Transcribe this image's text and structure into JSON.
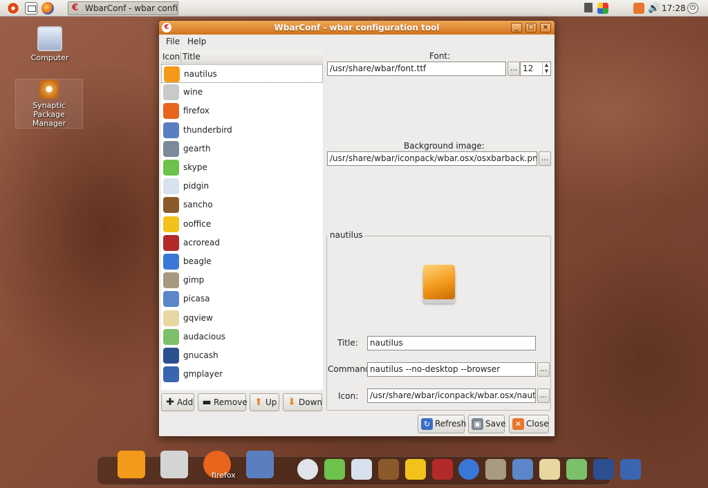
{
  "top_panel": {
    "task_title": "WbarConf - wbar confi...",
    "clock": "17:28",
    "icons": [
      "ubuntu-menu-icon",
      "show-desktop-icon",
      "firefox-icon",
      "network-icon",
      "update-notifier-icon",
      "notification-icon",
      "volume-icon",
      "power-icon"
    ]
  },
  "desktop": {
    "icons": [
      {
        "label": "Computer",
        "icon": "computer-icon"
      },
      {
        "label": "Synaptic Package Manager",
        "icon": "synaptic-icon"
      }
    ]
  },
  "window": {
    "title": "WbarConf - wbar configuration tool",
    "controls": {
      "minimize": "_",
      "maximize": "□",
      "close": "×"
    },
    "menu": {
      "file": "File",
      "help": "Help"
    },
    "list": {
      "columns": {
        "icon": "Icon",
        "title": "Title"
      },
      "selected": "nautilus",
      "items": [
        {
          "label": "nautilus",
          "color": "#f49a1a"
        },
        {
          "label": "wine",
          "color": "#c9c9c9"
        },
        {
          "label": "firefox",
          "color": "#e8651b"
        },
        {
          "label": "thunderbird",
          "color": "#5a7fc0"
        },
        {
          "label": "gearth",
          "color": "#7a8a9a"
        },
        {
          "label": "skype",
          "color": "#6cc24a"
        },
        {
          "label": "pidgin",
          "color": "#d8e2ee"
        },
        {
          "label": "sancho",
          "color": "#8b5a2b"
        },
        {
          "label": "ooffice",
          "color": "#f2c21a"
        },
        {
          "label": "acroread",
          "color": "#b22a2a"
        },
        {
          "label": "beagle",
          "color": "#3a78d8"
        },
        {
          "label": "gimp",
          "color": "#a89a80"
        },
        {
          "label": "picasa",
          "color": "#5b86c9"
        },
        {
          "label": "gqview",
          "color": "#e7d7a0"
        },
        {
          "label": "audacious",
          "color": "#7cc06a"
        },
        {
          "label": "gnucash",
          "color": "#2c4f8f"
        },
        {
          "label": "gmplayer",
          "color": "#3a66b0"
        }
      ]
    },
    "list_buttons": {
      "add": "Add",
      "remove": "Remove",
      "up": "Up",
      "down": "Down"
    },
    "font": {
      "label": "Font:",
      "path": "/usr/share/wbar/font.ttf",
      "browse": "...",
      "size": "12"
    },
    "background": {
      "label": "Background image:",
      "path": "/usr/share/wbar/iconpack/wbar.osx/osxbarback.png",
      "browse": "..."
    },
    "item": {
      "frame_title": "nautilus",
      "title_label": "Title:",
      "title_value": "nautilus",
      "command_label": "Command:",
      "command_value": "nautilus --no-desktop --browser",
      "icon_label": "Icon:",
      "icon_value": "/usr/share/wbar/iconpack/wbar.osx/nautilus.pn",
      "browse": "..."
    },
    "actions": {
      "refresh": "Refresh",
      "save": "Save",
      "close": "Close"
    }
  },
  "dock": {
    "hover_label": "firefox",
    "items": [
      {
        "name": "nautilus",
        "color": "#f49a1a"
      },
      {
        "name": "wine",
        "color": "#d4d4d4"
      },
      {
        "name": "firefox",
        "color": "#e8651b"
      },
      {
        "name": "thunderbird",
        "color": "#5a7fc0"
      },
      {
        "name": "gearth",
        "color": "#e0e4ea"
      },
      {
        "name": "skype",
        "color": "#6cc24a"
      },
      {
        "name": "pidgin",
        "color": "#d8e2ee"
      },
      {
        "name": "sancho",
        "color": "#8b5a2b"
      },
      {
        "name": "ooffice",
        "color": "#f2c21a"
      },
      {
        "name": "acroread",
        "color": "#b22a2a"
      },
      {
        "name": "beagle",
        "color": "#3a78d8"
      },
      {
        "name": "gimp",
        "color": "#a89a80"
      },
      {
        "name": "picasa",
        "color": "#5b86c9"
      },
      {
        "name": "gqview",
        "color": "#e7d7a0"
      },
      {
        "name": "audacious",
        "color": "#7cc06a"
      },
      {
        "name": "gnucash",
        "color": "#2c4f8f"
      },
      {
        "name": "gmplayer",
        "color": "#3a66b0"
      }
    ]
  }
}
